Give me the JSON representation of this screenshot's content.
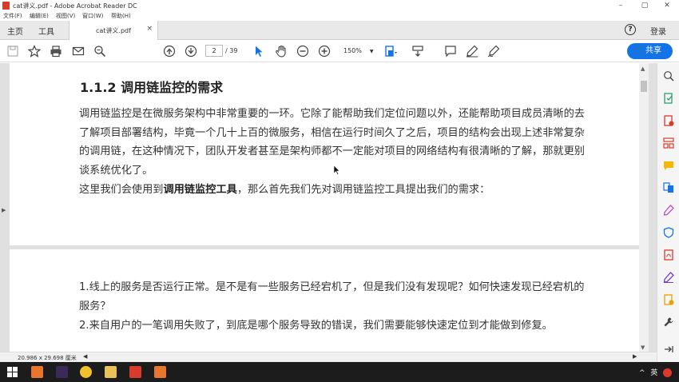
{
  "window": {
    "title": "cat讲义.pdf - Adobe Acrobat Reader DC",
    "minimize": "–",
    "maximize": "▢",
    "close": "✕"
  },
  "menu": [
    "文件(F)",
    "编辑(E)",
    "视图(V)",
    "窗口(W)",
    "帮助(H)"
  ],
  "tabs": {
    "home": "主页",
    "tools": "工具",
    "document": "cat讲义.pdf",
    "close": "×",
    "help": "?",
    "login": "登录"
  },
  "toolbar": {
    "page_current": "2",
    "page_total": "/ 39",
    "zoom": "150%",
    "share_label": "共享"
  },
  "document": {
    "heading": "1.1.2 调用链监控的需求",
    "para1": "调用链监控是在微服务架构中非常重要的一环。它除了能帮助我们定位问题以外，还能帮助项目成员清晰的去了解项目部署结构，毕竟一个几十上百的微服务，相信在运行时间久了之后，项目的结构会出现上述非常复杂的调用链，在这种情况下，团队开发者甚至是架构师都不一定能对项目的网络结构有很清晰的了解，那就更别谈系统优化了。",
    "para2_prefix": "这里我们会使用到",
    "para2_bold": "调用链监控工具",
    "para2_suffix": "，那么首先我们先对调用链监控工具提出我们的需求：",
    "para3": "1.线上的服务是否运行正常。是不是有一些服务已经宕机了，但是我们没有发现呢？如何快速发现已经宕机的服务？",
    "para4": "2.来自用户的一笔调用失败了，到底是哪个服务导致的错误，我们需要能够快速定位到才能做到修复。"
  },
  "status": {
    "page_size": "20.986 x 29.698 厘米"
  },
  "tray": {
    "arrow": "^",
    "ime": "英"
  },
  "colors": {
    "accent": "#1473e6",
    "acrobat_red": "#d83b2b"
  }
}
